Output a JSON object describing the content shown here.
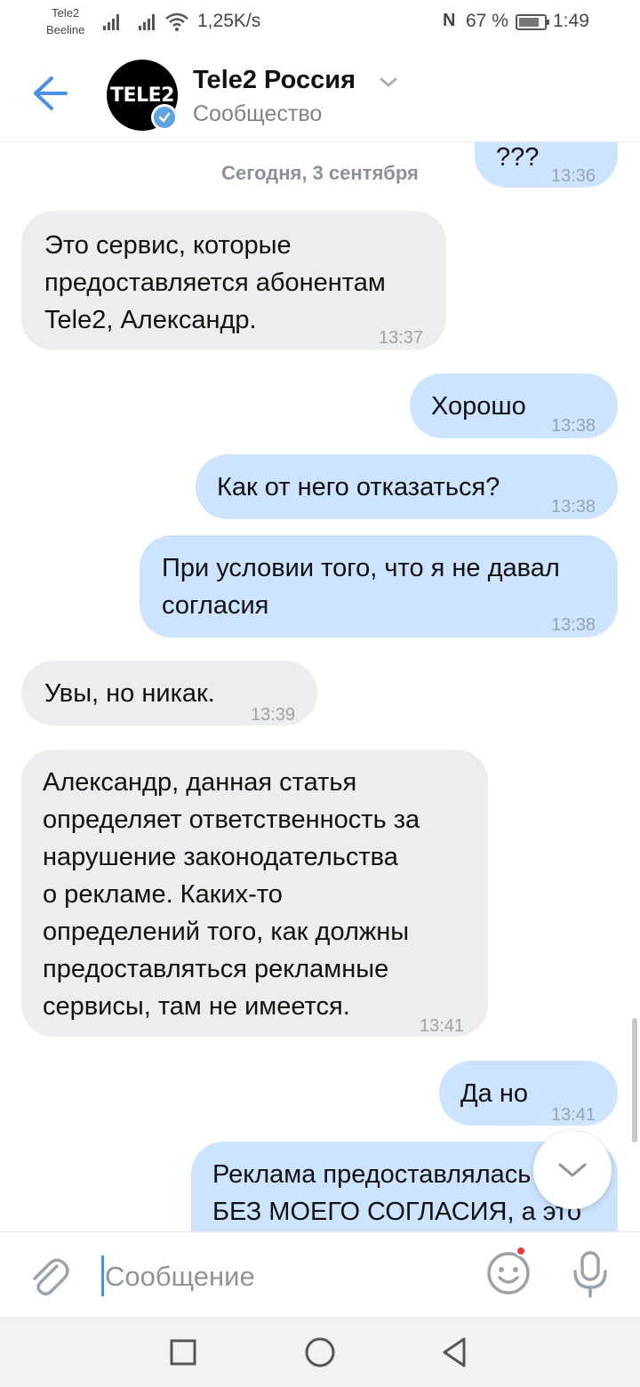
{
  "status_bar": {
    "operator_1": "Tele2",
    "operator_2": "Beeline",
    "net_speed": "1,25K/s",
    "battery_percent": "67 %",
    "time": "1:49"
  },
  "header": {
    "avatar_text": "TELE2",
    "title": "Tele2 Россия",
    "subtitle": "Сообщество"
  },
  "chat": {
    "date_separator": "Сегодня, 3 сентября",
    "messages": [
      {
        "direction": "out",
        "text": "???",
        "time": "13:36"
      },
      {
        "direction": "in",
        "text": "Это сервис, которые\nпредоставляется абонентам\nTele2, Александр.",
        "time": "13:37"
      },
      {
        "direction": "out",
        "text": "Хорошо",
        "time": "13:38"
      },
      {
        "direction": "out",
        "text": "Как от него отказаться?",
        "time": "13:38"
      },
      {
        "direction": "out",
        "text": "При условии того, что я не давал\nсогласия",
        "time": "13:38"
      },
      {
        "direction": "in",
        "text": "Увы, но никак.",
        "time": "13:39"
      },
      {
        "direction": "in",
        "text": "Александр, данная статья\nопределяет ответственность за\nнарушение законодательства\nо рекламе. Каких-то\nопределений того, как должны\nпредоставляться рекламные\nсервисы, там не имеется.",
        "time": "13:41"
      },
      {
        "direction": "out",
        "text": "Да но",
        "time": "13:41"
      },
      {
        "direction": "out",
        "text": "Реклама предоставлялась\nБЕЗ МОЕГО СОГЛАСИЯ, а это",
        "time": ""
      }
    ]
  },
  "composer": {
    "placeholder": "Сообщение",
    "value": ""
  },
  "icons": {
    "back": "arrow-left-icon",
    "verified": "checkmark-icon",
    "attach": "paperclip-icon",
    "emoji": "smile-icon",
    "mic": "microphone-icon",
    "scroll_down": "chevron-down-icon"
  },
  "colors": {
    "accent": "#4b8fe8",
    "outgoing_bubble": "#cce4ff",
    "incoming_bubble": "#ebedf0",
    "timestamp": "#99a2ad"
  }
}
